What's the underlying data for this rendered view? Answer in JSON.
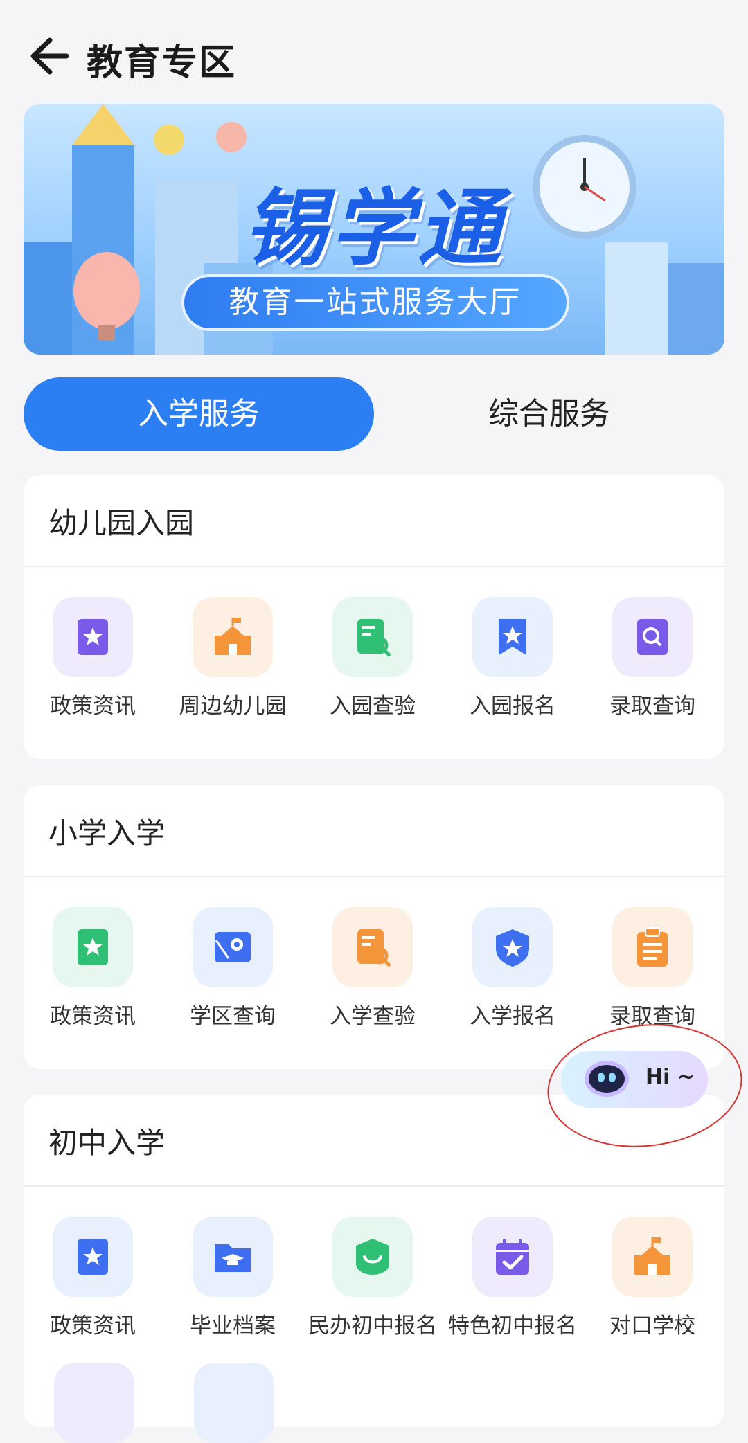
{
  "header": {
    "title": "教育专区"
  },
  "banner": {
    "title": "锡学通",
    "subtitle": "教育一站式服务大厅"
  },
  "tabs": [
    {
      "label": "入学服务",
      "active": true
    },
    {
      "label": "综合服务",
      "active": false
    }
  ],
  "sections": [
    {
      "title": "幼儿园入园",
      "items": [
        {
          "label": "政策资讯",
          "icon": "policy-doc-icon",
          "color": "purple"
        },
        {
          "label": "周边幼儿园",
          "icon": "school-building-icon",
          "color": "orange"
        },
        {
          "label": "入园查验",
          "icon": "doc-search-icon",
          "color": "green"
        },
        {
          "label": "入园报名",
          "icon": "bookmark-star-icon",
          "color": "blue"
        },
        {
          "label": "录取查询",
          "icon": "search-doc-icon",
          "color": "purple"
        }
      ]
    },
    {
      "title": "小学入学",
      "items": [
        {
          "label": "政策资讯",
          "icon": "policy-doc-icon",
          "color": "green"
        },
        {
          "label": "学区查询",
          "icon": "map-pin-icon",
          "color": "blue"
        },
        {
          "label": "入学查验",
          "icon": "doc-search-icon",
          "color": "orange"
        },
        {
          "label": "入学报名",
          "icon": "shield-star-icon",
          "color": "blue"
        },
        {
          "label": "录取查询",
          "icon": "clipboard-icon",
          "color": "orange"
        }
      ]
    },
    {
      "title": "初中入学",
      "items": [
        {
          "label": "政策资讯",
          "icon": "policy-doc-icon",
          "color": "blue"
        },
        {
          "label": "毕业档案",
          "icon": "folder-graduation-icon",
          "color": "blue"
        },
        {
          "label": "民办初中报名",
          "icon": "grad-cap-icon",
          "color": "green"
        },
        {
          "label": "特色初中报名",
          "icon": "calendar-check-icon",
          "color": "purple"
        },
        {
          "label": "对口学校",
          "icon": "school-building-icon",
          "color": "orange"
        }
      ]
    }
  ],
  "assistant": {
    "text": "Hi ~"
  },
  "colors": {
    "accent": "#2b7ff3",
    "background": "#f5f5f7",
    "highlight_ring": "#d73434"
  }
}
